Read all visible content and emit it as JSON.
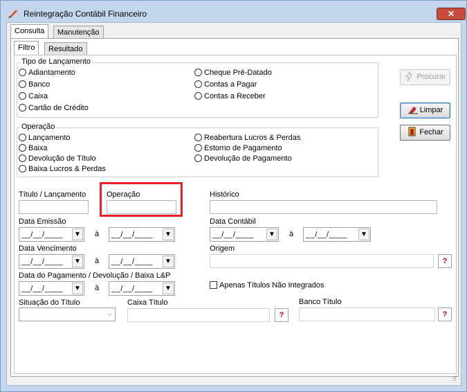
{
  "window": {
    "title": "Reintegração Contábil Financeiro",
    "close_label": "✕"
  },
  "tabs": {
    "main": [
      "Consulta",
      "Manutenção"
    ],
    "sub": [
      "Filtro",
      "Resultado"
    ]
  },
  "tipo_lancamento": {
    "legend": "Tipo de Lançamento",
    "left": [
      "Adiantamento",
      "Banco",
      "Caixa",
      "Cartão de Crédito"
    ],
    "right": [
      "Cheque Pré-Datado",
      "Contas a Pagar",
      "Contas a Receber"
    ]
  },
  "operacao_group": {
    "legend": "Operação",
    "left": [
      "Lançamento",
      "Baixa",
      "Devolução de Título",
      "Baixa Lucros & Perdas"
    ],
    "right": [
      "Reabertura Lucros & Perdas",
      "Estorno de Pagamento",
      "Devolução de Pagamento"
    ]
  },
  "buttons": {
    "procurar": "Procurar",
    "limpar": "Limpar",
    "fechar": "Fechar"
  },
  "fields": {
    "titulo_lancamento": "Título / Lançamento",
    "operacao": "Operação",
    "historico": "Histórico",
    "data_emissao": "Data Emissão",
    "data_contabil": "Data Contábil",
    "data_vencimento": "Data Vencimento",
    "origem": "Origem",
    "data_pagamento": "Data do Pagamento / Devolução / Baixa L&P",
    "apenas_titulos": "Apenas Títulos Não Integrados",
    "situacao_titulo": "Situação do Título",
    "caixa_titulo": "Caixa Título",
    "banco_titulo": "Banco Título"
  },
  "date_mask": "__/__/____",
  "range_sep": "à",
  "help_glyph": "?"
}
